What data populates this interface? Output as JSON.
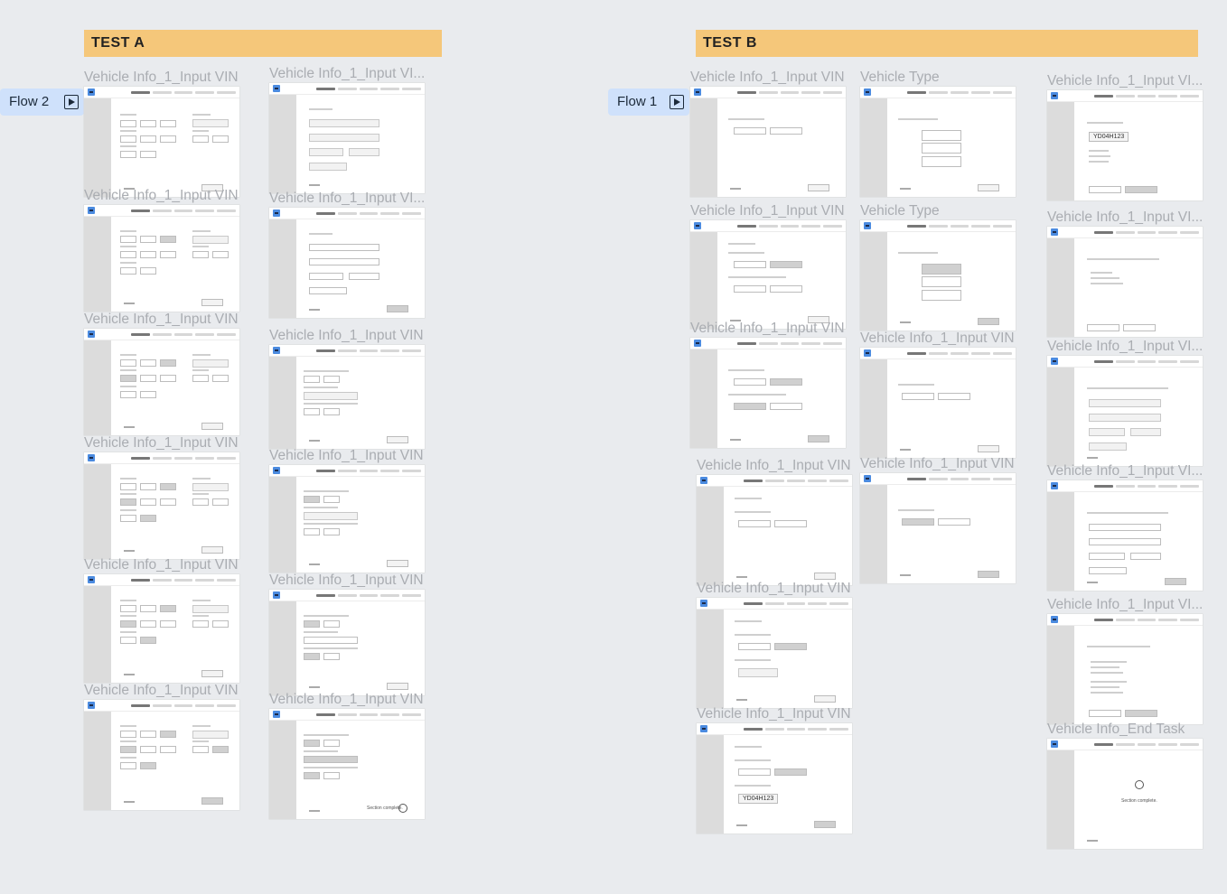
{
  "test_a": {
    "title": "TEST A",
    "flow_label": "Flow 2",
    "col1_labels": [
      "Vehicle Info_1_Input VIN",
      "Vehicle Info_1_Input VIN",
      "Vehicle Info_1_Input VIN",
      "Vehicle Info_1_Input VIN",
      "Vehicle Info_1_Input VIN",
      "Vehicle Info_1_Input VIN"
    ],
    "col2_labels": [
      "Vehicle Info_1_Input VI...",
      "Vehicle Info_1_Input VI...",
      "Vehicle Info_1_Input VIN",
      "Vehicle Info_1_Input VIN",
      "Vehicle Info_1_Input VIN",
      "Vehicle Info_1_Input VIN"
    ]
  },
  "test_b": {
    "title": "TEST B",
    "flow_label": "Flow 1",
    "col1_labels": [
      "Vehicle Info_1_Input VIN",
      "Vehicle Info_1_Input VIN",
      "Vehicle Info_1_Input VIN",
      "Vehicle Info_1_Input VIN",
      "Vehicle Info_1_Input VIN",
      "Vehicle Info_1_Input VIN"
    ],
    "col2_labels": [
      "Vehicle Type",
      "Vehicle Type",
      "Vehicle Info_1_Input VIN",
      "Vehicle Info_1_Input VIN"
    ],
    "col3_labels": [
      "Vehicle Info_1_Input VI...",
      "Vehicle Info_1_Input VI...",
      "Vehicle Info_1_Input VI...",
      "Vehicle Info_1_Input VI...",
      "Vehicle Info_1_Input VI...",
      "Vehicle Info_End Task"
    ]
  },
  "screen_text": {
    "plate_value": "YD04H123",
    "section_complete": "Section complete."
  },
  "colors": {
    "header": "#f5c77a",
    "flow_chip": "#cfe1fb",
    "canvas": "#e9ebee",
    "frame_label": "#aaadb2"
  }
}
